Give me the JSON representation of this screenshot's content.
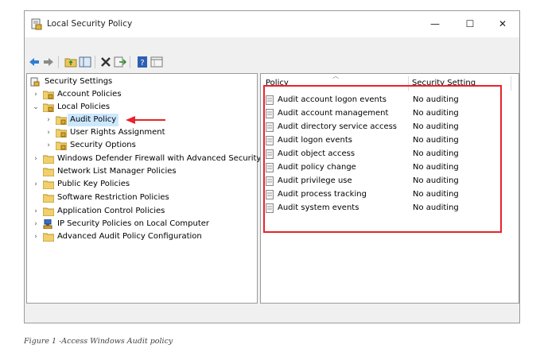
{
  "window": {
    "title": "Local Security Policy",
    "controls": {
      "minimize": "—",
      "maximize": "☐",
      "close": "✕"
    }
  },
  "toolbar": {
    "icons": [
      "back-arrow-icon",
      "forward-arrow-icon",
      "up-folder-icon",
      "show-hide-tree-icon",
      "delete-icon",
      "export-list-icon",
      "help-icon",
      "properties-icon"
    ]
  },
  "tree": {
    "root": "Security Settings",
    "items": [
      {
        "label": "Account Policies",
        "expander": "›"
      },
      {
        "label": "Local Policies",
        "expander": "⌄"
      },
      {
        "label": "Audit Policy",
        "expander": "›"
      },
      {
        "label": "User Rights Assignment",
        "expander": "›"
      },
      {
        "label": "Security Options",
        "expander": "›"
      },
      {
        "label": "Windows Defender Firewall with Advanced Security",
        "expander": "›"
      },
      {
        "label": "Network List Manager Policies",
        "expander": ""
      },
      {
        "label": "Public Key Policies",
        "expander": "›"
      },
      {
        "label": "Software Restriction Policies",
        "expander": ""
      },
      {
        "label": "Application Control Policies",
        "expander": "›"
      },
      {
        "label": "IP Security Policies on Local Computer",
        "expander": "›"
      },
      {
        "label": "Advanced Audit Policy Configuration",
        "expander": "›"
      }
    ]
  },
  "list": {
    "columns": {
      "policy": "Policy",
      "setting": "Security Setting"
    },
    "rows": [
      {
        "policy": "Audit account logon events",
        "setting": "No auditing"
      },
      {
        "policy": "Audit account management",
        "setting": "No auditing"
      },
      {
        "policy": "Audit directory service access",
        "setting": "No auditing"
      },
      {
        "policy": "Audit logon events",
        "setting": "No auditing"
      },
      {
        "policy": "Audit object access",
        "setting": "No auditing"
      },
      {
        "policy": "Audit policy change",
        "setting": "No auditing"
      },
      {
        "policy": "Audit privilege use",
        "setting": "No auditing"
      },
      {
        "policy": "Audit process tracking",
        "setting": "No auditing"
      },
      {
        "policy": "Audit system events",
        "setting": "No auditing"
      }
    ]
  },
  "annotation": {
    "color": "#e8232b"
  },
  "caption": "Figure 1 -Access Windows Audit policy"
}
